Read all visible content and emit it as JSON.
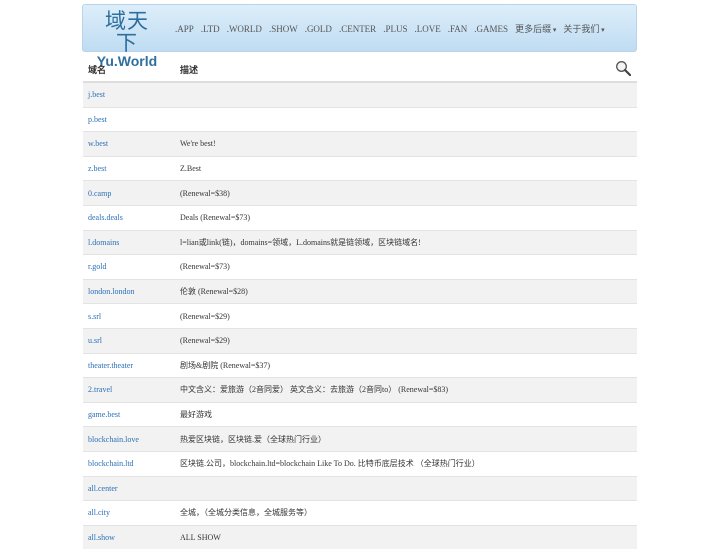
{
  "brand": {
    "cn": "域天下",
    "en": "Yu.World"
  },
  "nav": [
    {
      "label": ".APP"
    },
    {
      "label": ".LTD"
    },
    {
      "label": ".WORLD"
    },
    {
      "label": ".SHOW"
    },
    {
      "label": ".GOLD"
    },
    {
      "label": ".CENTER"
    },
    {
      "label": ".PLUS"
    },
    {
      "label": ".LOVE"
    },
    {
      "label": ".FAN"
    },
    {
      "label": ".GAMES"
    },
    {
      "label": "更多后缀"
    },
    {
      "label": "关于我们"
    }
  ],
  "table": {
    "headers": {
      "domain": "域名",
      "desc": "描述"
    },
    "rows": [
      {
        "domain": "j.best",
        "desc": ""
      },
      {
        "domain": "p.best",
        "desc": ""
      },
      {
        "domain": "w.best",
        "desc": "We're best!"
      },
      {
        "domain": "z.best",
        "desc": "Z.Best"
      },
      {
        "domain": "0.camp",
        "desc": "(Renewal=$38)"
      },
      {
        "domain": "deals.deals",
        "desc": "Deals (Renewal=$73)"
      },
      {
        "domain": "l.domains",
        "desc": "l=lian或link(链)，domains=领域，L.domains就是链领域，区块链域名!"
      },
      {
        "domain": "r.gold",
        "desc": "(Renewal=$73)"
      },
      {
        "domain": "london.london",
        "desc": "伦敦 (Renewal=$28)"
      },
      {
        "domain": "s.srl",
        "desc": "(Renewal=$29)"
      },
      {
        "domain": "u.srl",
        "desc": "(Renewal=$29)"
      },
      {
        "domain": "theater.theater",
        "desc": "剧场&剧院 (Renewal=$37)"
      },
      {
        "domain": "2.travel",
        "desc": "中文含义：爱旅游（2音同爱） 英文含义：去旅游（2音同to） (Renewal=$83)"
      },
      {
        "domain": "game.best",
        "desc": "最好游戏"
      },
      {
        "domain": "blockchain.love",
        "desc": "热爱区块链，区块链.爱（全球热门行业）"
      },
      {
        "domain": "blockchain.ltd",
        "desc": "区块链.公司，blockchain.ltd=blockchain Like To Do. 比特币底层技术 （全球热门行业）"
      },
      {
        "domain": "all.center",
        "desc": ""
      },
      {
        "domain": "all.city",
        "desc": "全城，（全城分类信息，全城服务等）"
      },
      {
        "domain": "all.show",
        "desc": "ALL SHOW"
      }
    ]
  },
  "icons": {
    "search": "search-icon"
  }
}
